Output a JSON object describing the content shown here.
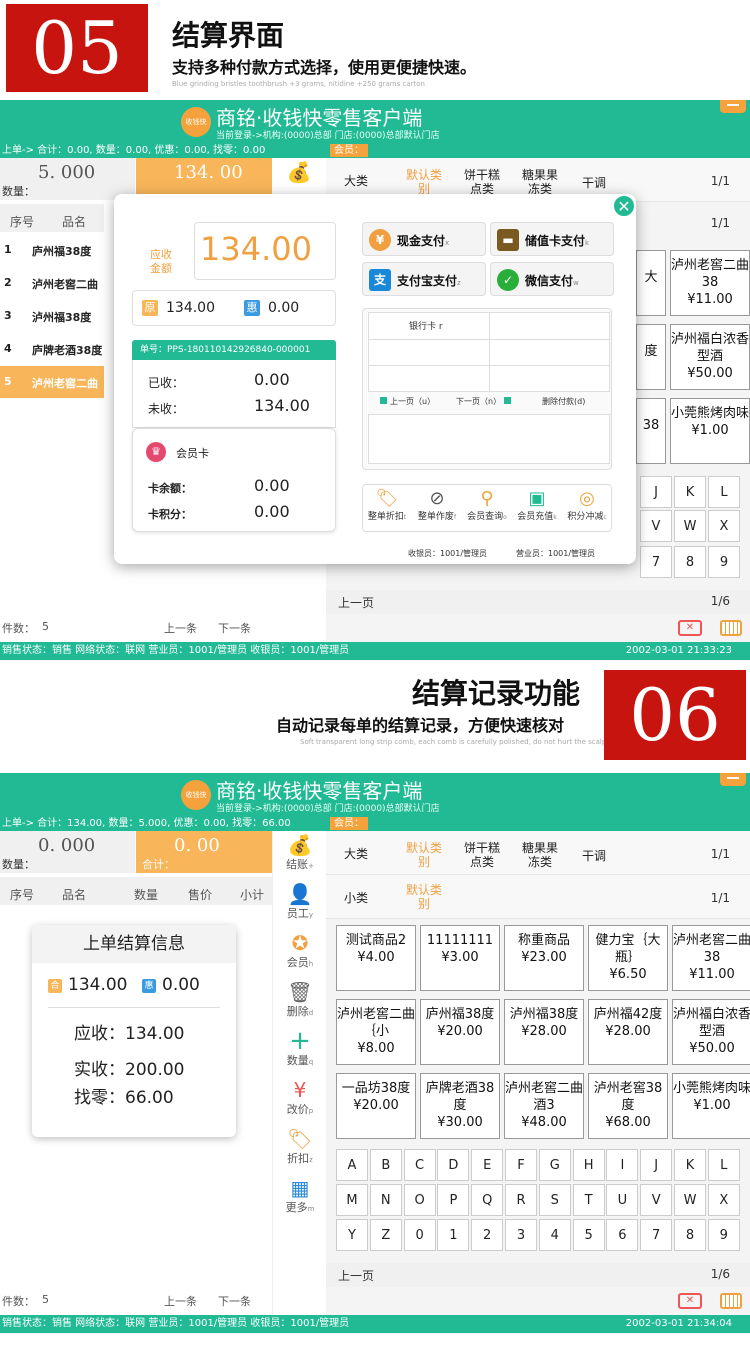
{
  "banner05": {
    "number": "05",
    "title": "结算界面",
    "subtitle": "支持多种付款方式选择，使用更便捷快速。",
    "tiny": "Blue grinding bristles toothbrush +3 grams, nitidine +250 grams carton"
  },
  "banner06": {
    "number": "06",
    "title": "结算记录功能",
    "subtitle": "自动记录每单的结算记录，方便快速核对",
    "tiny": "Soft transparent long strip comb, each comb is carefully polished, do not hurt the scalp"
  },
  "app1": {
    "logo_text": "收钱快",
    "title": "商铭·收钱快零售客户端",
    "subtitle": "当前登录->机构:(0000)总部 门店:(0000)总部默认门店",
    "info": "上单-> 合计：0.00, 数量：0.00, 优惠：0.00, 找零：0.00",
    "member": "会员：",
    "qty_value": "5. 000",
    "qty_label": "数量：",
    "total_value": "134. 00",
    "col_no": "序号",
    "col_name": "品名",
    "orders": [
      {
        "no": "1",
        "name": "庐州福38度"
      },
      {
        "no": "2",
        "name": "泸州老窖二曲"
      },
      {
        "no": "3",
        "name": "泸州福38度"
      },
      {
        "no": "4",
        "name": "庐牌老酒38度"
      },
      {
        "no": "5",
        "name": "泸州老窖二曲"
      }
    ],
    "count_label": "件数：",
    "count_value": "5",
    "prev": "上一条",
    "next": "下一条",
    "cat_big": "大类",
    "cats": [
      "默认类别",
      "饼干糕点类",
      "糖果果冻类",
      "干调"
    ],
    "page1": "1/1",
    "page2": "1/1",
    "products_visible": [
      {
        "name": "泸州老窖二曲38",
        "price": "¥11.00",
        "frag": "大"
      },
      {
        "name": "泸州福白浓香型酒",
        "price": "¥50.00",
        "frag": "度"
      },
      {
        "name": "小莞熊烤肉味",
        "price": "¥1.00",
        "frag": "38"
      }
    ],
    "keys_visible": [
      "J",
      "K",
      "L",
      "V",
      "W",
      "X",
      "7",
      "8",
      "9"
    ],
    "prev_page": "上一页",
    "page_count": "1/6",
    "status": "销售状态：销售   网络状态：联网   营业员：1001/管理员   收银员：1001/管理员",
    "datetime": "2002-03-01  21:33:23"
  },
  "modal": {
    "due_label": "应收金额",
    "due_value": "134.00",
    "orig_badge": "原",
    "orig_value": "134.00",
    "disc_badge": "惠",
    "disc_value": "0.00",
    "order_no": "单号：PPS-180110142926840-000001",
    "received_label": "已收：",
    "received_value": "0.00",
    "unpaid_label": "未收：",
    "unpaid_value": "134.00",
    "member_card": "会员卡",
    "card_balance_label": "卡余额：",
    "card_balance_value": "0.00",
    "card_points_label": "卡积分：",
    "card_points_value": "0.00",
    "pay_cash": "现金支付",
    "pay_cash_key": "x",
    "pay_card": "储值卡支付",
    "pay_card_key": "k",
    "pay_alipay": "支付宝支付",
    "pay_alipay_key": "z",
    "pay_wechat": "微信支付",
    "pay_wechat_key": "w",
    "bank_card": "银行卡 r",
    "prev_page": "上一页（u）",
    "next_page": "下一页（n）",
    "delete_payment": "删除付款(d)",
    "fn_buttons": [
      "整单折扣",
      "整单作废",
      "会员查询",
      "会员充值",
      "积分冲减"
    ],
    "fn_keys": [
      "t",
      "f",
      "o",
      "k",
      "c"
    ],
    "cashier": "收银员：1001/管理员",
    "clerk": "营业员：1001/管理员"
  },
  "app2": {
    "info": "上单-> 合计：134.00, 数量：5.000, 优惠：0.00, 找零：66.00",
    "member": "会员：",
    "qty_value": "0. 000",
    "qty_label": "数量：",
    "total_value": "0. 00",
    "total_label": "合计：",
    "cols": [
      "序号",
      "品名",
      "数量",
      "售价",
      "小计"
    ],
    "card_title": "上单结算信息",
    "card_orig_badge": "合",
    "card_orig": "134.00",
    "card_disc_badge": "惠",
    "card_disc": "0.00",
    "due": "应收：134.00",
    "paid": "实收：200.00",
    "change": "找零：66.00",
    "count_label": "件数：",
    "count_value": "5",
    "prev": "上一条",
    "next": "下一条",
    "tools": [
      {
        "label": "结账",
        "key": "+"
      },
      {
        "label": "员工",
        "key": "y"
      },
      {
        "label": "会员",
        "key": "h"
      },
      {
        "label": "删除",
        "key": "d"
      },
      {
        "label": "数量",
        "key": "q"
      },
      {
        "label": "改价",
        "key": "p"
      },
      {
        "label": "折扣",
        "key": "z"
      },
      {
        "label": "更多",
        "key": "m"
      }
    ],
    "cat_big": "大类",
    "cat_small": "小类",
    "cats": [
      "默认类别",
      "饼干糕点类",
      "糖果果冻类",
      "干调"
    ],
    "subcat": "默认类别",
    "page1": "1/1",
    "page2": "1/1",
    "products": [
      {
        "name": "测试商品2",
        "price": "¥4.00"
      },
      {
        "name": "11111111",
        "price": "¥3.00"
      },
      {
        "name": "称重商品",
        "price": "¥23.00"
      },
      {
        "name": "健力宝｛大瓶｝",
        "price": "¥6.50"
      },
      {
        "name": "泸州老窖二曲38",
        "price": "¥11.00"
      },
      {
        "name": "泸州老窖二曲｛小",
        "price": "¥8.00"
      },
      {
        "name": "庐州福38度",
        "price": "¥20.00"
      },
      {
        "name": "泸州福38度",
        "price": "¥28.00"
      },
      {
        "name": "庐州福42度",
        "price": "¥28.00"
      },
      {
        "name": "泸州福白浓香型酒",
        "price": "¥50.00"
      },
      {
        "name": "一品坊38度",
        "price": "¥20.00"
      },
      {
        "name": "庐牌老酒38度",
        "price": "¥30.00"
      },
      {
        "name": "泸州老窖二曲酒3",
        "price": "¥48.00"
      },
      {
        "name": "泸州老窖38度",
        "price": "¥68.00"
      },
      {
        "name": "小莞熊烤肉味",
        "price": "¥1.00"
      }
    ],
    "keys": [
      "A",
      "B",
      "C",
      "D",
      "E",
      "F",
      "G",
      "H",
      "I",
      "J",
      "K",
      "L",
      "M",
      "N",
      "O",
      "P",
      "Q",
      "R",
      "S",
      "T",
      "U",
      "V",
      "W",
      "X",
      "Y",
      "Z",
      "0",
      "1",
      "2",
      "3",
      "4",
      "5",
      "6",
      "7",
      "8",
      "9"
    ],
    "prev_page": "上一页",
    "page_count": "1/6",
    "status": "销售状态：销售   网络状态：联网   营业员：1001/管理员   收银员：1001/管理员",
    "datetime": "2002-03-01  21:34:04"
  }
}
